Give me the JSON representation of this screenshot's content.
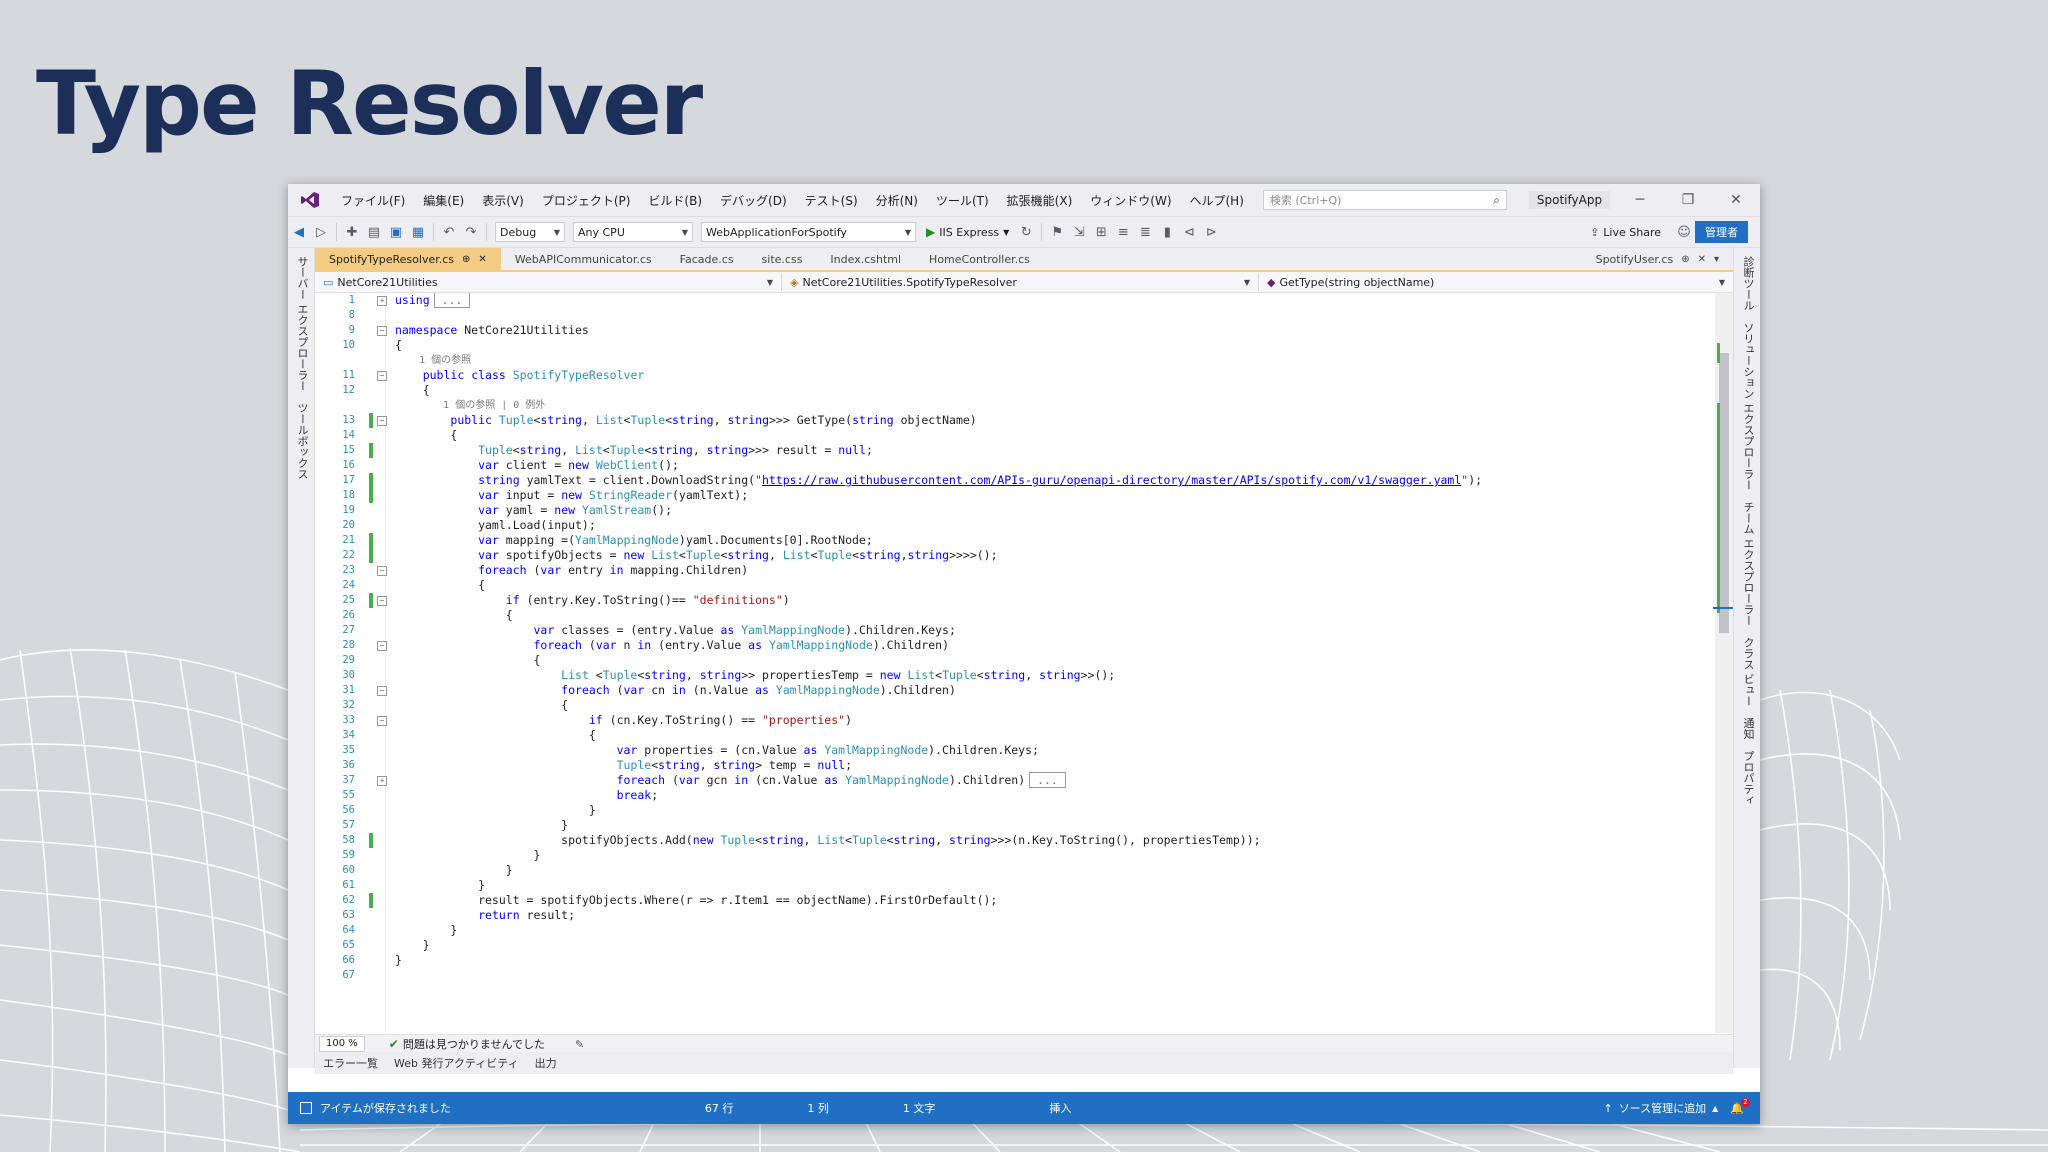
{
  "slide": {
    "title": "Type Resolver"
  },
  "titlebar": {
    "menu": [
      "ファイル(F)",
      "編集(E)",
      "表示(V)",
      "プロジェクト(P)",
      "ビルド(B)",
      "デバッグ(D)",
      "テスト(S)",
      "分析(N)",
      "ツール(T)",
      "拡張機能(X)",
      "ウィンドウ(W)",
      "ヘルプ(H)"
    ],
    "search_placeholder": "検索 (Ctrl+Q)",
    "app_name": "SpotifyApp",
    "minimize": "─",
    "restore": "❐",
    "close": "✕"
  },
  "toolbar": {
    "config": "Debug",
    "platform": "Any CPU",
    "project": "WebApplicationForSpotify",
    "run_label": "IIS Express",
    "live_share": "Live Share",
    "admin": "管理者"
  },
  "rails": {
    "left": "サーバー エクスプローラー　ツールボックス",
    "right": "診断ツール　ソリューション エクスプローラー　チーム エクスプローラー　クラス ビュー　通知　プロパティ"
  },
  "tabs": [
    {
      "label": "SpotifyTypeResolver.cs",
      "active": true
    },
    {
      "label": "WebAPICommunicator.cs",
      "active": false
    },
    {
      "label": "Facade.cs",
      "active": false
    },
    {
      "label": "site.css",
      "active": false
    },
    {
      "label": "Index.cshtml",
      "active": false
    },
    {
      "label": "HomeController.cs",
      "active": false
    }
  ],
  "tab_right": "SpotifyUser.cs",
  "navbar": {
    "project": "NetCore21Utilities",
    "type": "NetCore21Utilities.SpotifyTypeResolver",
    "member": "GetType(string objectName)"
  },
  "code_lines": [
    {
      "n": "1",
      "text": "using",
      "fold": "+",
      "chg": false
    },
    {
      "n": "8",
      "text": "",
      "fold": "",
      "chg": false
    },
    {
      "n": "9",
      "text": "namespace NetCore21Utilities",
      "fold": "-",
      "chg": false
    },
    {
      "n": "10",
      "text": "{",
      "fold": "",
      "chg": false
    },
    {
      "n": "",
      "text": "    1 個の参照",
      "fold": "",
      "chg": false
    },
    {
      "n": "11",
      "text": "    public class SpotifyTypeResolver",
      "fold": "-",
      "chg": false
    },
    {
      "n": "12",
      "text": "    {",
      "fold": "",
      "chg": false
    },
    {
      "n": "",
      "text": "        1 個の参照 | 0 例外",
      "fold": "",
      "chg": false
    },
    {
      "n": "13",
      "text": "        public Tuple<string, List<Tuple<string, string>>> GetType(string objectName)",
      "fold": "-",
      "chg": true
    },
    {
      "n": "14",
      "text": "        {",
      "fold": "",
      "chg": false
    },
    {
      "n": "15",
      "text": "            Tuple<string, List<Tuple<string, string>>> result = null;",
      "fold": "",
      "chg": true
    },
    {
      "n": "16",
      "text": "            var client = new WebClient();",
      "fold": "",
      "chg": false
    },
    {
      "n": "17",
      "text": "            string yamlText = client.DownloadString(\"https://raw.githubusercontent.com/APIs-guru/openapi-directory/master/APIs/spotify.com/v1/swagger.yaml\");",
      "fold": "",
      "chg": true
    },
    {
      "n": "18",
      "text": "            var input = new StringReader(yamlText);",
      "fold": "",
      "chg": true
    },
    {
      "n": "19",
      "text": "            var yaml = new YamlStream();",
      "fold": "",
      "chg": false
    },
    {
      "n": "20",
      "text": "            yaml.Load(input);",
      "fold": "",
      "chg": false
    },
    {
      "n": "21",
      "text": "            var mapping =(YamlMappingNode)yaml.Documents[0].RootNode;",
      "fold": "",
      "chg": true
    },
    {
      "n": "22",
      "text": "            var spotifyObjects = new List<Tuple<string, List<Tuple<string,string>>>>();",
      "fold": "",
      "chg": true
    },
    {
      "n": "23",
      "text": "            foreach (var entry in mapping.Children)",
      "fold": "-",
      "chg": false
    },
    {
      "n": "24",
      "text": "            {",
      "fold": "",
      "chg": false
    },
    {
      "n": "25",
      "text": "                if (entry.Key.ToString()== \"definitions\")",
      "fold": "-",
      "chg": true
    },
    {
      "n": "26",
      "text": "                {",
      "fold": "",
      "chg": false
    },
    {
      "n": "27",
      "text": "                    var classes = (entry.Value as YamlMappingNode).Children.Keys;",
      "fold": "",
      "chg": false
    },
    {
      "n": "28",
      "text": "                    foreach (var n in (entry.Value as YamlMappingNode).Children)",
      "fold": "-",
      "chg": false
    },
    {
      "n": "29",
      "text": "                    {",
      "fold": "",
      "chg": false
    },
    {
      "n": "30",
      "text": "                        List <Tuple<string, string>> propertiesTemp = new List<Tuple<string, string>>();",
      "fold": "",
      "chg": false
    },
    {
      "n": "31",
      "text": "                        foreach (var cn in (n.Value as YamlMappingNode).Children)",
      "fold": "-",
      "chg": false
    },
    {
      "n": "32",
      "text": "                        {",
      "fold": "",
      "chg": false
    },
    {
      "n": "33",
      "text": "                            if (cn.Key.ToString() == \"properties\")",
      "fold": "-",
      "chg": false
    },
    {
      "n": "34",
      "text": "                            {",
      "fold": "",
      "chg": false
    },
    {
      "n": "35",
      "text": "                                var properties = (cn.Value as YamlMappingNode).Children.Keys;",
      "fold": "",
      "chg": false
    },
    {
      "n": "36",
      "text": "                                Tuple<string, string> temp = null;",
      "fold": "",
      "chg": false
    },
    {
      "n": "37",
      "text": "                                foreach (var gcn in (cn.Value as YamlMappingNode).Children)",
      "fold": "+",
      "chg": false
    },
    {
      "n": "55",
      "text": "                                break;",
      "fold": "",
      "chg": false
    },
    {
      "n": "56",
      "text": "                            }",
      "fold": "",
      "chg": false
    },
    {
      "n": "57",
      "text": "                        }",
      "fold": "",
      "chg": false
    },
    {
      "n": "58",
      "text": "                        spotifyObjects.Add(new Tuple<string, List<Tuple<string, string>>>(n.Key.ToString(), propertiesTemp));",
      "fold": "",
      "chg": true
    },
    {
      "n": "59",
      "text": "                    }",
      "fold": "",
      "chg": false
    },
    {
      "n": "60",
      "text": "                }",
      "fold": "",
      "chg": false
    },
    {
      "n": "61",
      "text": "            }",
      "fold": "",
      "chg": false
    },
    {
      "n": "62",
      "text": "            result = spotifyObjects.Where(r => r.Item1 == objectName).FirstOrDefault();",
      "fold": "",
      "chg": true
    },
    {
      "n": "63",
      "text": "            return result;",
      "fold": "",
      "chg": false
    },
    {
      "n": "64",
      "text": "        }",
      "fold": "",
      "chg": false
    },
    {
      "n": "65",
      "text": "    }",
      "fold": "",
      "chg": false
    },
    {
      "n": "66",
      "text": "}",
      "fold": "",
      "chg": false
    },
    {
      "n": "67",
      "text": "",
      "fold": "",
      "chg": false
    }
  ],
  "editor_status": {
    "zoom": "100 %",
    "issues": "問題は見つかりませんでした"
  },
  "bottom_tabs": [
    "エラー一覧",
    "Web 発行アクティビティ",
    "出力"
  ],
  "statusbar": {
    "message": "アイテムが保存されました",
    "line": "67 行",
    "col": "1 列",
    "char": "1 文字",
    "mode": "挿入",
    "source_control": "ソース管理に追加",
    "notifications": "2"
  },
  "colors": {
    "title": "#1b2f59",
    "accent": "#1f6fc4",
    "active_tab": "#f5cc84",
    "keyword": "#0000ff",
    "type": "#2b91af",
    "string": "#a31515",
    "change_marker": "#48b048"
  }
}
